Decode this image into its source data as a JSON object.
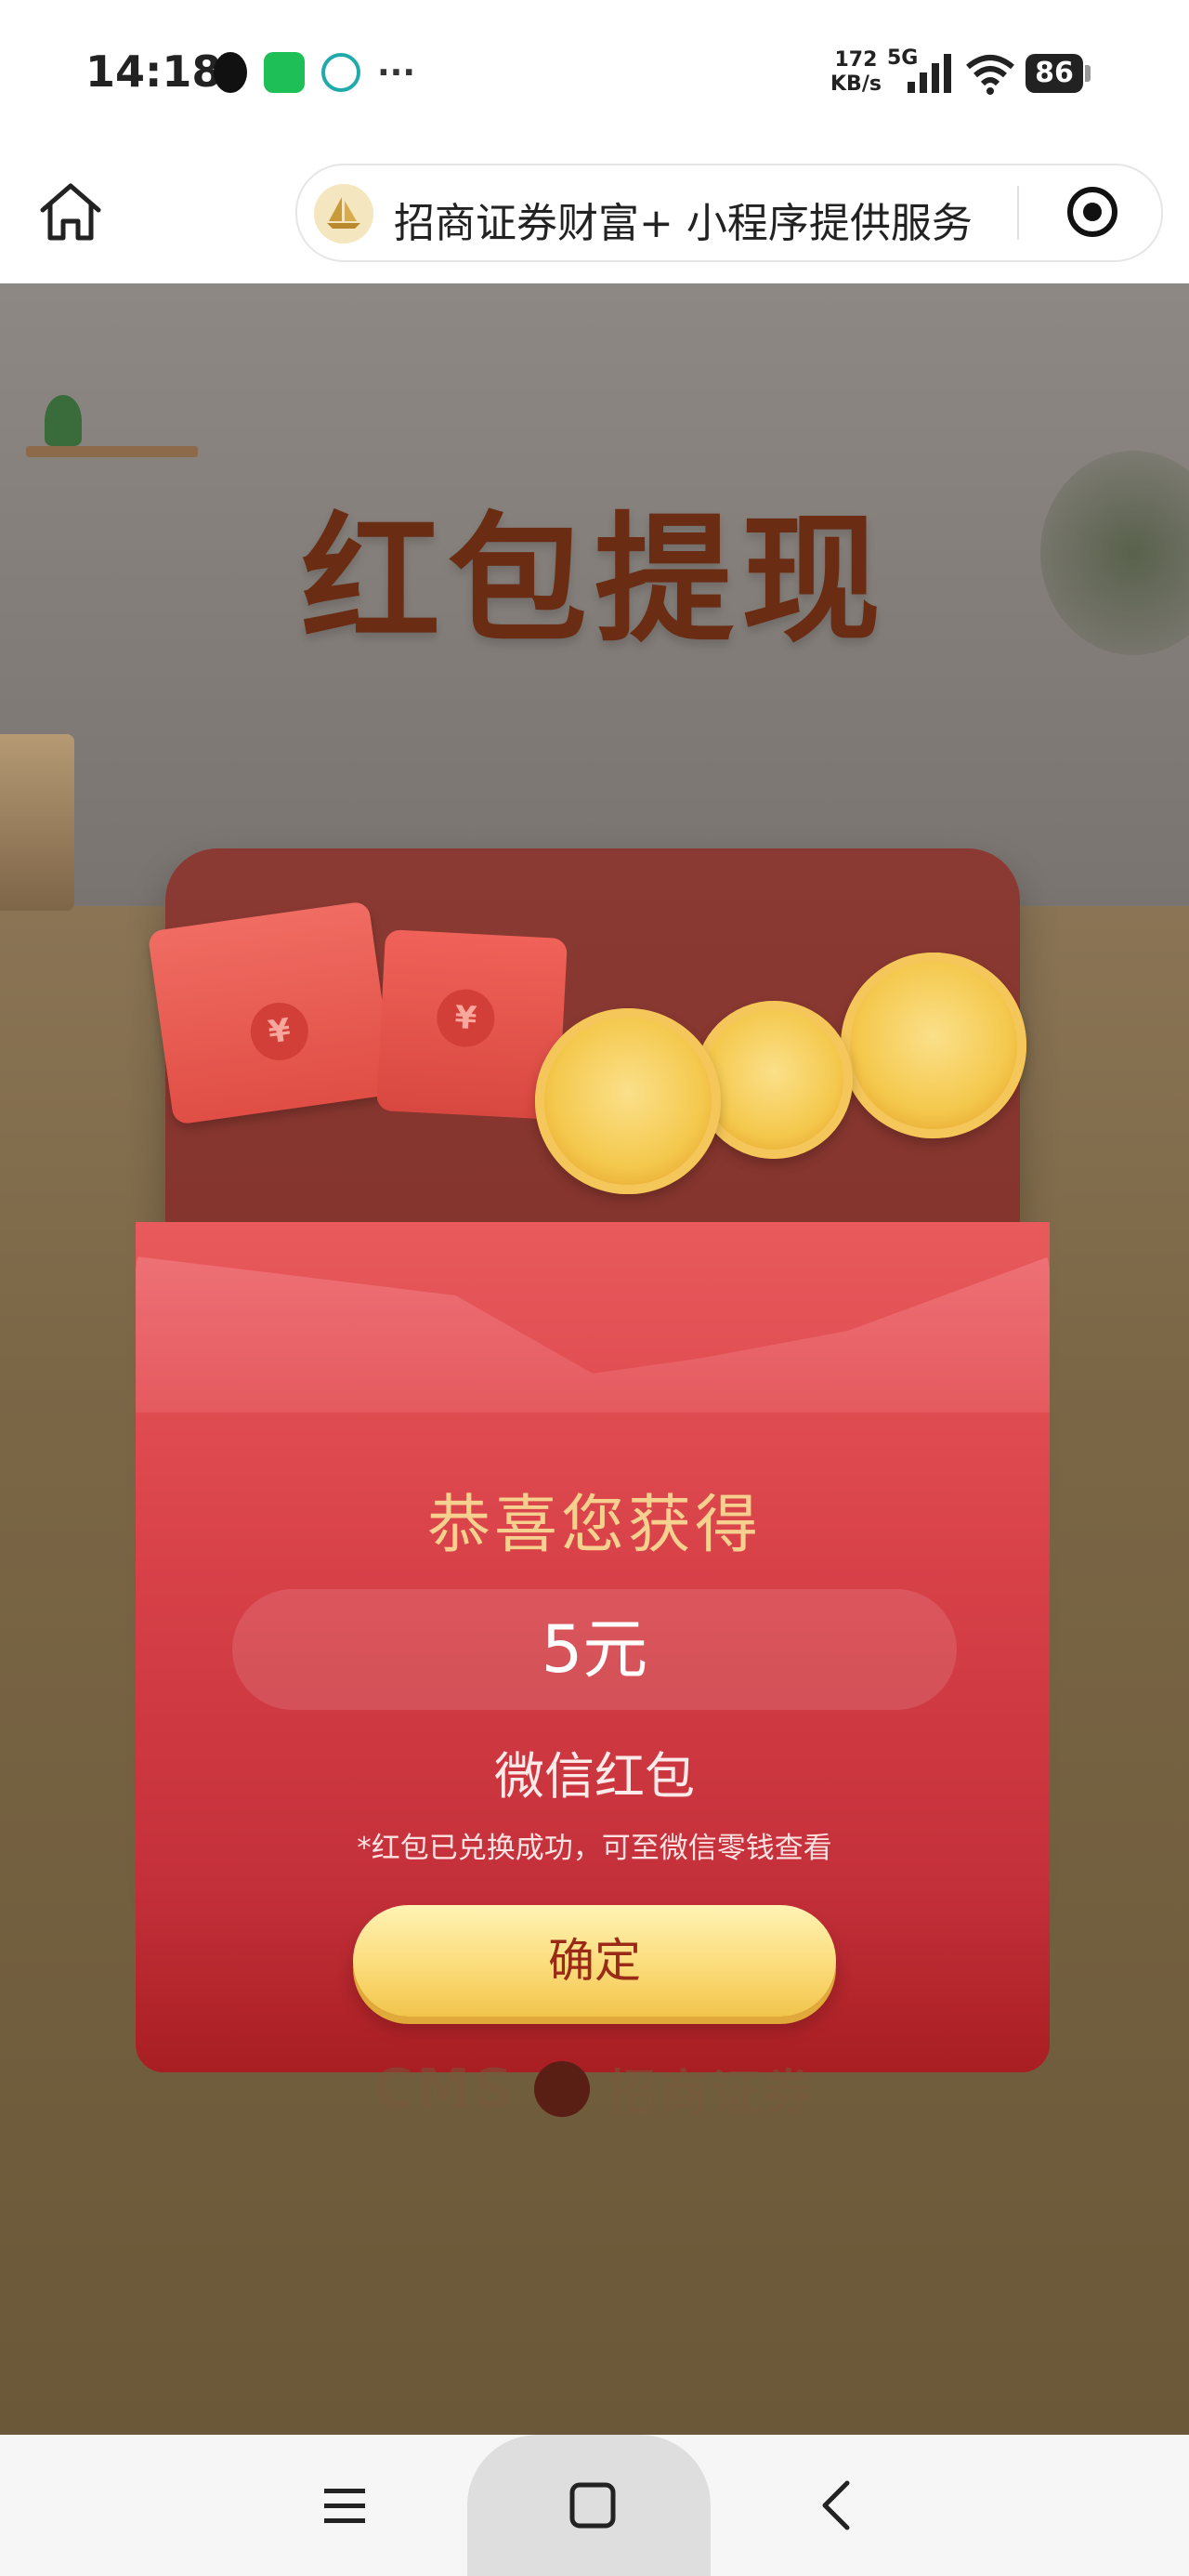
{
  "status_bar": {
    "time": "14:18",
    "net_speed_value": "172",
    "net_speed_unit": "KB/s",
    "network_type": "5G",
    "battery": "86",
    "notification_icons": [
      "qq-icon",
      "wechat-icon",
      "miniprogram-icon",
      "more-icon"
    ]
  },
  "header": {
    "home_icon": "home-icon",
    "capsule_text": "招商证券财富+ 小程序提供服务",
    "capsule_logo": "sailboat-logo",
    "capsule_action_icon": "target-icon"
  },
  "main": {
    "headline": "红包提现",
    "congrats": "恭喜您获得",
    "amount": "5元",
    "reward_type": "微信红包",
    "notice": "*红包已兑换成功，可至微信零钱查看",
    "confirm_label": "确定",
    "envelope_symbol": "¥",
    "brand_en": "CMS",
    "brand_cn": "招商证券"
  },
  "colors": {
    "packet_red": "#d84148",
    "gold_text": "#f5d08e",
    "button_gold": "#fbdc7a",
    "headline_brown": "#6a2d14"
  },
  "nav_bar": {
    "menu_icon": "menu-icon",
    "home_icon": "square-home-icon",
    "back_icon": "back-arrow-icon"
  }
}
